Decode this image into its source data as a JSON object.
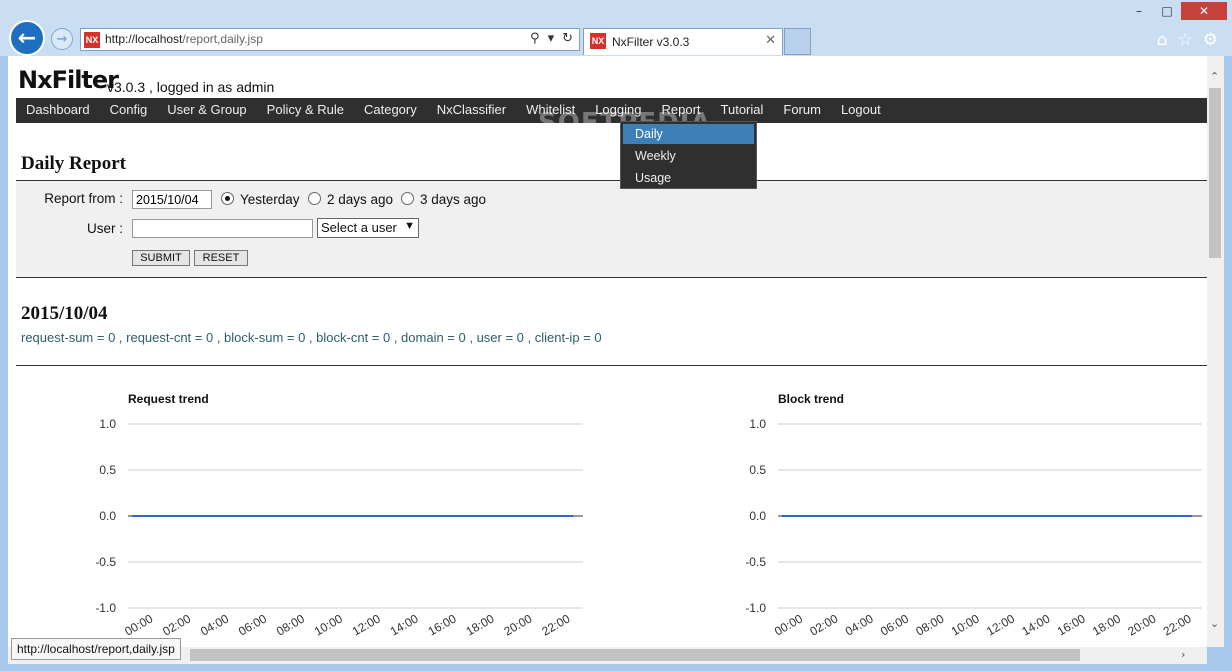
{
  "browser": {
    "url_host": "http://localhost",
    "url_path": "/report,daily.jsp",
    "tab_title": "NxFilter v3.0.3",
    "tab_icon": "NX",
    "status_url": "http://localhost/report,daily.jsp"
  },
  "header": {
    "logo": "NxFilter",
    "version": "v3.0.3 , logged in as admin"
  },
  "nav": [
    "Dashboard",
    "Config",
    "User & Group",
    "Policy & Rule",
    "Category",
    "NxClassifier",
    "Whitelist",
    "Logging",
    "Report",
    "Tutorial",
    "Forum",
    "Logout"
  ],
  "report_menu": {
    "items": [
      "Daily",
      "Weekly",
      "Usage"
    ],
    "selected": "Daily"
  },
  "watermark": "SOFTPEDIA",
  "page_title": "Daily Report",
  "form": {
    "report_from_label": "Report from :",
    "date_value": "2015/10/04",
    "radios": [
      "Yesterday",
      "2 days ago",
      "3 days ago"
    ],
    "radio_selected": "Yesterday",
    "user_label": "User :",
    "user_value": "",
    "user_select": "Select a user",
    "submit": "SUBMIT",
    "reset": "RESET"
  },
  "report": {
    "date": "2015/10/04",
    "stats": "request-sum = 0 , request-cnt = 0 , block-sum = 0 , block-cnt = 0 , domain = 0 , user = 0 , client-ip = 0"
  },
  "colors": {
    "nav_bg": "#2f2f2f",
    "menu_selected": "#3d80b7",
    "stats_text": "#2d5f6e",
    "series_line": "#3366cc"
  },
  "chart_data": [
    {
      "type": "line",
      "title": "Request trend",
      "x": [
        "00:00",
        "02:00",
        "04:00",
        "06:00",
        "08:00",
        "10:00",
        "12:00",
        "14:00",
        "16:00",
        "18:00",
        "20:00",
        "22:00"
      ],
      "series": [
        {
          "values": [
            0,
            0,
            0,
            0,
            0,
            0,
            0,
            0,
            0,
            0,
            0,
            0
          ]
        }
      ],
      "yticks": [
        "1.0",
        "0.5",
        "0.0",
        "-0.5",
        "-1.0"
      ],
      "ylim": [
        -1,
        1
      ],
      "grid": true
    },
    {
      "type": "line",
      "title": "Block trend",
      "x": [
        "00:00",
        "02:00",
        "04:00",
        "06:00",
        "08:00",
        "10:00",
        "12:00",
        "14:00",
        "16:00",
        "18:00",
        "20:00",
        "22:00"
      ],
      "series": [
        {
          "values": [
            0,
            0,
            0,
            0,
            0,
            0,
            0,
            0,
            0,
            0,
            0,
            0
          ]
        }
      ],
      "yticks": [
        "1.0",
        "0.5",
        "0.0",
        "-0.5",
        "-1.0"
      ],
      "ylim": [
        -1,
        1
      ],
      "grid": true
    }
  ]
}
